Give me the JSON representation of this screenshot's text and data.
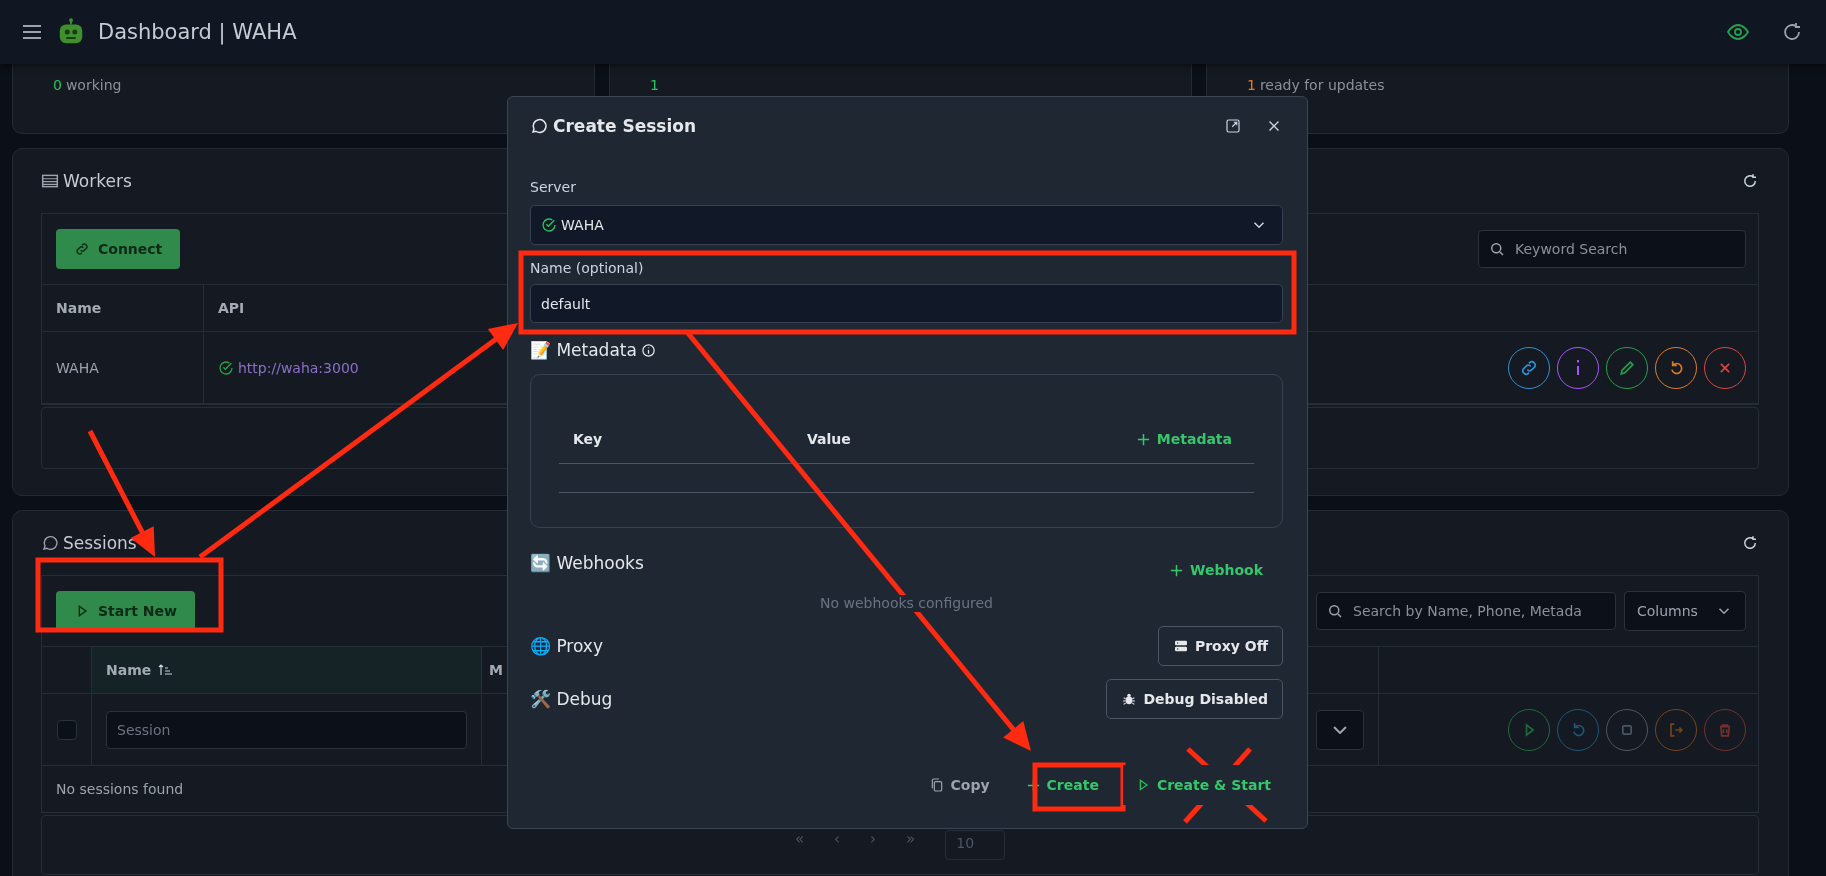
{
  "header": {
    "title": "Dashboard | WAHA"
  },
  "stats": [
    {
      "value": "0",
      "label": "working",
      "color": "#22c55e"
    },
    {
      "value": "1",
      "color": "#22c55e"
    },
    {
      "value": "1",
      "label": "ready for updates",
      "color": "#f97316"
    }
  ],
  "workers": {
    "title": "Workers",
    "connect_button": "Connect",
    "search_placeholder": "Keyword Search",
    "columns": [
      "Name",
      "API"
    ],
    "rows": [
      {
        "name": "WAHA",
        "api": "http://waha:3000",
        "healthy": true,
        "actions": [
          {
            "kind": "link",
            "color": "#2f8fd0"
          },
          {
            "kind": "info",
            "color": "#a855f7"
          },
          {
            "kind": "edit",
            "color": "#22a04b"
          },
          {
            "kind": "restart",
            "color": "#e07a1f"
          },
          {
            "kind": "delete",
            "color": "#d9463e"
          }
        ]
      }
    ]
  },
  "sessions": {
    "title": "Sessions",
    "start_button": "Start New",
    "search_placeholder": "Search by Name, Phone, Metada",
    "columns_button": "Columns",
    "columns": [
      {
        "label": "Name",
        "sorted": true
      },
      {
        "label": "M"
      }
    ],
    "filter": {
      "checked": false,
      "placeholder": "Session"
    },
    "actions": [
      {
        "kind": "play",
        "color": "#1e6a3a"
      },
      {
        "kind": "restart",
        "color": "#1f5577"
      },
      {
        "kind": "stop",
        "color": "#4b5563"
      },
      {
        "kind": "logout",
        "color": "#74431d"
      },
      {
        "kind": "delete",
        "color": "#72302c"
      }
    ],
    "empty_text": "No sessions found",
    "pagination": {
      "pages": [
        "«",
        "‹",
        "›",
        "»"
      ],
      "page_size": "10"
    }
  },
  "modal": {
    "title": "Create Session",
    "server": {
      "label": "Server",
      "value": "WAHA",
      "healthy": true
    },
    "name": {
      "label": "Name (optional)",
      "value": "default"
    },
    "metadata": {
      "title": "📝 Metadata",
      "columns": [
        "Key",
        "Value"
      ],
      "add_button": "Metadata"
    },
    "webhooks": {
      "title": "🔄 Webhooks",
      "add_button": "Webhook",
      "empty_text": "No webhooks configured"
    },
    "proxy": {
      "title": "🌐 Proxy",
      "button": "Proxy Off"
    },
    "debug": {
      "title": "🛠️ Debug",
      "button": "Debug Disabled"
    },
    "footer_buttons": [
      {
        "kind": "copy",
        "label": "Copy"
      },
      {
        "kind": "create",
        "label": "Create"
      },
      {
        "kind": "start",
        "label": "Create & Start"
      }
    ]
  },
  "annotations": [
    {
      "kind": "arrow"
    },
    {
      "kind": "arrow"
    },
    {
      "kind": "box"
    },
    {
      "kind": "box"
    },
    {
      "kind": "arrow"
    },
    {
      "kind": "box"
    },
    {
      "kind": "cross"
    }
  ]
}
